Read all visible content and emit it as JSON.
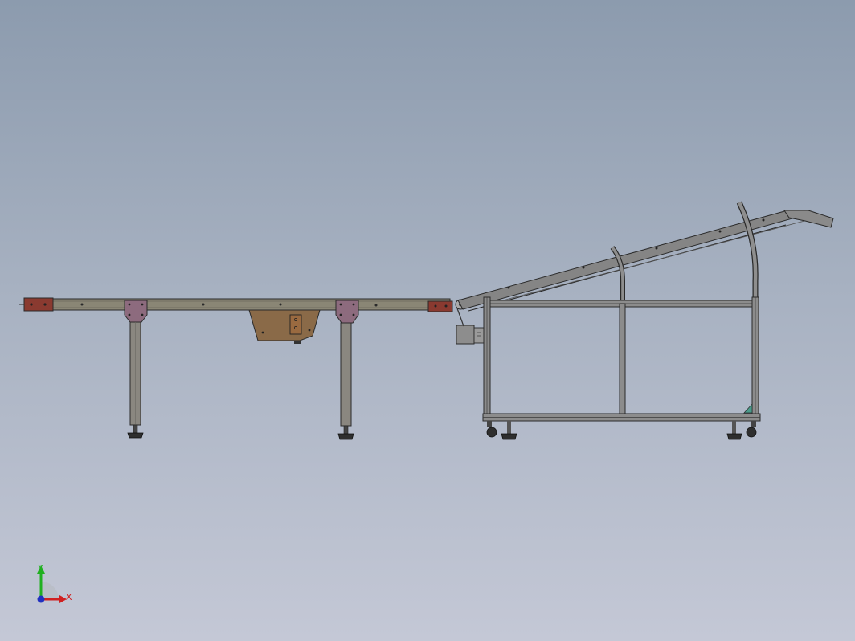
{
  "viewport": {
    "background_top": "#8c9bae",
    "background_bottom": "#c4c8d6"
  },
  "model": {
    "assembly_1": {
      "beam_color": "#8a8675",
      "end_cap_color": "#8a3a30",
      "bracket_color": "#8d6b7e",
      "leg_color": "#8a8780",
      "motor_housing_color": "#8a6a48",
      "foot_color": "#2e2e2e"
    },
    "assembly_2": {
      "frame_color": "#8c8c8c",
      "frame_dark_color": "#3a3a3a",
      "incline_color": "#858585",
      "caster_color": "#2e2e2e",
      "accent_color": "#4a9a8a"
    }
  },
  "triad": {
    "x_label": "X",
    "y_label": "Y",
    "x_color": "#d02020",
    "y_color": "#20b020",
    "z_color": "#2030c0",
    "icon": "coordinate-triad-icon"
  }
}
